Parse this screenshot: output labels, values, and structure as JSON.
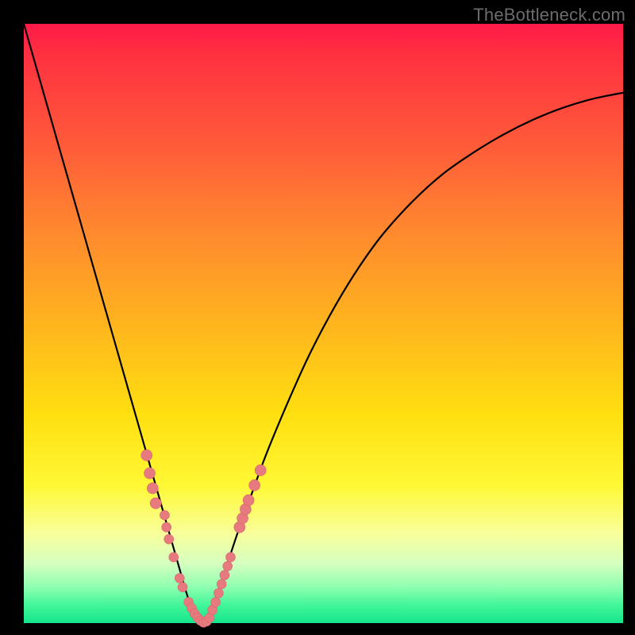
{
  "watermark": "TheBottleneck.com",
  "colors": {
    "frame": "#000000",
    "curve": "#000000",
    "marker_fill": "#e77a7e",
    "marker_stroke": "#d6686c"
  },
  "chart_data": {
    "type": "line",
    "title": "",
    "xlabel": "",
    "ylabel": "",
    "xlim": [
      0,
      100
    ],
    "ylim": [
      0,
      100
    ],
    "grid": false,
    "legend": false,
    "series": [
      {
        "name": "bottleneck-curve",
        "x": [
          0,
          2,
          4,
          6,
          8,
          10,
          12,
          14,
          16,
          18,
          20,
          21,
          22,
          23,
          24,
          25,
          26,
          27,
          28,
          29,
          30,
          31,
          32,
          33,
          34,
          36,
          38,
          40,
          42,
          45,
          48,
          52,
          56,
          60,
          65,
          70,
          75,
          80,
          85,
          90,
          95,
          100
        ],
        "values": [
          100,
          93,
          86,
          79,
          72,
          65,
          58,
          51,
          44,
          37,
          30,
          26.5,
          23,
          19.5,
          16,
          12.5,
          9,
          5.5,
          2.5,
          0.8,
          0,
          1.3,
          4,
          7,
          10,
          16,
          21.5,
          27,
          32,
          39,
          45.5,
          53,
          59.5,
          65,
          70.5,
          75,
          78.5,
          81.5,
          84,
          86,
          87.5,
          88.5
        ]
      }
    ],
    "markers": [
      {
        "x": 20.5,
        "y": 28,
        "size": 7
      },
      {
        "x": 21.0,
        "y": 25,
        "size": 7
      },
      {
        "x": 21.5,
        "y": 22.5,
        "size": 7
      },
      {
        "x": 22.0,
        "y": 20,
        "size": 7
      },
      {
        "x": 23.5,
        "y": 18,
        "size": 6
      },
      {
        "x": 23.8,
        "y": 16,
        "size": 6
      },
      {
        "x": 24.2,
        "y": 14,
        "size": 6
      },
      {
        "x": 25.0,
        "y": 11,
        "size": 6
      },
      {
        "x": 26.0,
        "y": 7.5,
        "size": 6
      },
      {
        "x": 26.5,
        "y": 6,
        "size": 6
      },
      {
        "x": 27.5,
        "y": 3.5,
        "size": 6
      },
      {
        "x": 28.0,
        "y": 2.5,
        "size": 6
      },
      {
        "x": 28.5,
        "y": 1.6,
        "size": 6
      },
      {
        "x": 29.0,
        "y": 0.9,
        "size": 6
      },
      {
        "x": 29.5,
        "y": 0.4,
        "size": 6
      },
      {
        "x": 30.0,
        "y": 0.1,
        "size": 6
      },
      {
        "x": 30.5,
        "y": 0.3,
        "size": 6
      },
      {
        "x": 31.0,
        "y": 0.9,
        "size": 6
      },
      {
        "x": 31.5,
        "y": 2.2,
        "size": 6
      },
      {
        "x": 32.0,
        "y": 3.5,
        "size": 6
      },
      {
        "x": 32.5,
        "y": 5,
        "size": 6
      },
      {
        "x": 33.0,
        "y": 6.5,
        "size": 6
      },
      {
        "x": 33.5,
        "y": 8,
        "size": 6
      },
      {
        "x": 34.0,
        "y": 9.5,
        "size": 6
      },
      {
        "x": 34.5,
        "y": 11,
        "size": 6
      },
      {
        "x": 36.0,
        "y": 16,
        "size": 7
      },
      {
        "x": 36.5,
        "y": 17.5,
        "size": 7
      },
      {
        "x": 37.0,
        "y": 19,
        "size": 7
      },
      {
        "x": 37.5,
        "y": 20.5,
        "size": 7
      },
      {
        "x": 38.5,
        "y": 23,
        "size": 7
      },
      {
        "x": 39.5,
        "y": 25.5,
        "size": 7
      }
    ],
    "annotations": []
  }
}
